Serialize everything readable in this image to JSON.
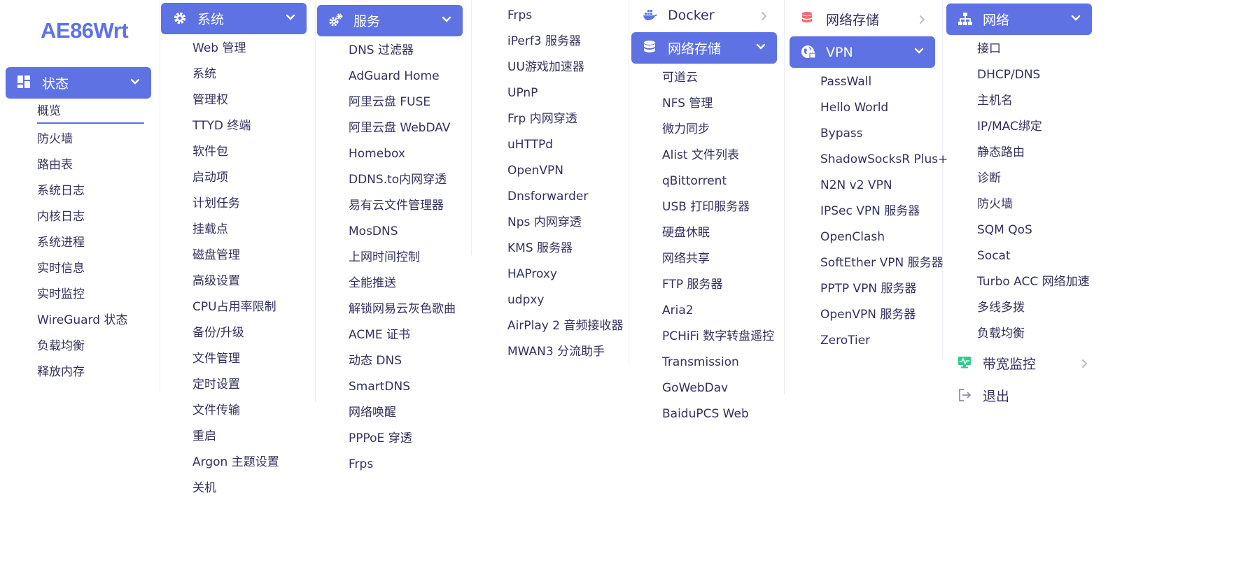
{
  "logo": "AE86Wrt",
  "colors": {
    "accent": "#5e72e4",
    "text": "#32325d",
    "muted": "#b7bcc9",
    "storage_icon": "#f5686f",
    "monitor_icon": "#2dce89"
  },
  "col1": {
    "header": "状态",
    "items": [
      "概览",
      "防火墙",
      "路由表",
      "系统日志",
      "内核日志",
      "系统进程",
      "实时信息",
      "实时监控",
      "WireGuard 状态",
      "负载均衡",
      "释放内存"
    ]
  },
  "col2": {
    "header": "系统",
    "items": [
      "Web 管理",
      "系统",
      "管理权",
      "TTYD 终端",
      "软件包",
      "启动项",
      "计划任务",
      "挂载点",
      "磁盘管理",
      "高级设置",
      "CPU占用率限制",
      "备份/升级",
      "文件管理",
      "定时设置",
      "文件传输",
      "重启",
      "Argon 主题设置",
      "关机"
    ]
  },
  "col3": {
    "header": "服务",
    "items": [
      "DNS 过滤器",
      "AdGuard Home",
      "阿里云盘 FUSE",
      "阿里云盘 WebDAV",
      "Homebox",
      "DDNS.to内网穿透",
      "易有云文件管理器",
      "MosDNS",
      "上网时间控制",
      "全能推送",
      "解锁网易云灰色歌曲",
      "ACME 证书",
      "动态 DNS",
      "SmartDNS",
      "网络唤醒",
      "PPPoE 穿透",
      "Frps"
    ]
  },
  "col4": {
    "items": [
      "Frps",
      "iPerf3 服务器",
      "UU游戏加速器",
      "UPnP",
      "Frp 内网穿透",
      "uHTTPd",
      "OpenVPN",
      "Dnsforwarder",
      "Nps 内网穿透",
      "KMS 服务器",
      "HAProxy",
      "udpxy",
      "AirPlay 2 音频接收器",
      "MWAN3 分流助手"
    ]
  },
  "col5": {
    "collapsed": "Docker",
    "header": "网络存储",
    "items": [
      "可道云",
      "NFS 管理",
      "微力同步",
      "Alist 文件列表",
      "qBittorrent",
      "USB 打印服务器",
      "硬盘休眠",
      "网络共享",
      "FTP 服务器",
      "Aria2",
      "PCHiFi 数字转盘遥控",
      "Transmission",
      "GoWebDav",
      "BaiduPCS Web"
    ]
  },
  "col6": {
    "collapsed": "网络存储",
    "header": "VPN",
    "items": [
      "PassWall",
      "Hello World",
      "Bypass",
      "ShadowSocksR Plus+",
      "N2N v2 VPN",
      "IPSec VPN 服务器",
      "OpenClash",
      "SoftEther VPN 服务器",
      "PPTP VPN 服务器",
      "OpenVPN 服务器",
      "ZeroTier"
    ]
  },
  "col7": {
    "header": "网络",
    "items": [
      "接口",
      "DHCP/DNS",
      "主机名",
      "IP/MAC绑定",
      "静态路由",
      "诊断",
      "防火墙",
      "SQM QoS",
      "Socat",
      "Turbo ACC 网络加速",
      "多线多拨",
      "负载均衡"
    ],
    "bandwidth": "带宽监控",
    "logout": "退出"
  }
}
